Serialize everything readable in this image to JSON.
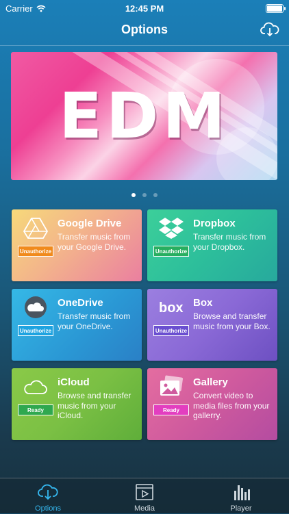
{
  "status_bar": {
    "carrier": "Carrier",
    "time": "12:45 PM"
  },
  "nav": {
    "title": "Options",
    "action_icon": "cloud-download-icon"
  },
  "banner": {
    "text": "EDM",
    "pages": 3,
    "current_page": 1
  },
  "cards": [
    {
      "title": "Google Drive",
      "description": "Transfer music from your Google Drive.",
      "status": "Unauthorize",
      "icon": "google-drive-icon",
      "status_color": "#f08a1c"
    },
    {
      "title": "Dropbox",
      "description": "Transfer music from your Dropbox.",
      "status": "Unauthorize",
      "icon": "dropbox-icon",
      "status_color": "#27ae60"
    },
    {
      "title": "OneDrive",
      "description": "Transfer music from your OneDrive.",
      "status": "Unauthorize",
      "icon": "onedrive-icon",
      "status_color": "#1ea3e0"
    },
    {
      "title": "Box",
      "description": "Browse and transfer music from your Box.",
      "status": "Unauthorize",
      "icon": "box-icon",
      "status_color": "#6a4fd0"
    },
    {
      "title": "iCloud",
      "description": "Browse and transfer music from your iCloud.",
      "status": "Ready",
      "icon": "icloud-icon",
      "status_color": "#2fa84f"
    },
    {
      "title": "Gallery",
      "description": "Convert video to media files from your gallerry.",
      "status": "Ready",
      "icon": "gallery-icon",
      "status_color": "#e33ec0"
    }
  ],
  "tabbar": {
    "items": [
      {
        "label": "Options",
        "icon": "cloud-download-icon",
        "active": true
      },
      {
        "label": "Media",
        "icon": "media-icon",
        "active": false
      },
      {
        "label": "Player",
        "icon": "equalizer-icon",
        "active": false
      }
    ],
    "accent": "#35b8f0"
  }
}
